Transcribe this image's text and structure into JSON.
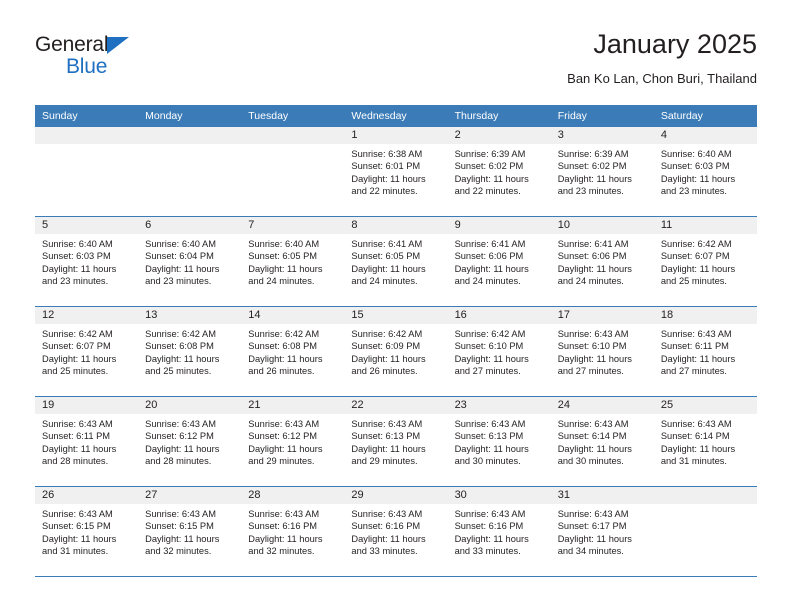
{
  "brand": {
    "line1": "General",
    "line2": "Blue",
    "accent_color": "#1f70c1"
  },
  "header": {
    "title": "January 2025",
    "subtitle": "Ban Ko Lan, Chon Buri, Thailand"
  },
  "theme": {
    "header_blue": "#3b7cb8",
    "daynum_band": "#f0f0f0",
    "text": "#231f20"
  },
  "weekdays": [
    "Sunday",
    "Monday",
    "Tuesday",
    "Wednesday",
    "Thursday",
    "Friday",
    "Saturday"
  ],
  "weeks": [
    [
      {
        "day": "",
        "sunrise": "",
        "sunset": "",
        "daylight1": "",
        "daylight2": ""
      },
      {
        "day": "",
        "sunrise": "",
        "sunset": "",
        "daylight1": "",
        "daylight2": ""
      },
      {
        "day": "",
        "sunrise": "",
        "sunset": "",
        "daylight1": "",
        "daylight2": ""
      },
      {
        "day": "1",
        "sunrise": "Sunrise: 6:38 AM",
        "sunset": "Sunset: 6:01 PM",
        "daylight1": "Daylight: 11 hours",
        "daylight2": "and 22 minutes."
      },
      {
        "day": "2",
        "sunrise": "Sunrise: 6:39 AM",
        "sunset": "Sunset: 6:02 PM",
        "daylight1": "Daylight: 11 hours",
        "daylight2": "and 22 minutes."
      },
      {
        "day": "3",
        "sunrise": "Sunrise: 6:39 AM",
        "sunset": "Sunset: 6:02 PM",
        "daylight1": "Daylight: 11 hours",
        "daylight2": "and 23 minutes."
      },
      {
        "day": "4",
        "sunrise": "Sunrise: 6:40 AM",
        "sunset": "Sunset: 6:03 PM",
        "daylight1": "Daylight: 11 hours",
        "daylight2": "and 23 minutes."
      }
    ],
    [
      {
        "day": "5",
        "sunrise": "Sunrise: 6:40 AM",
        "sunset": "Sunset: 6:03 PM",
        "daylight1": "Daylight: 11 hours",
        "daylight2": "and 23 minutes."
      },
      {
        "day": "6",
        "sunrise": "Sunrise: 6:40 AM",
        "sunset": "Sunset: 6:04 PM",
        "daylight1": "Daylight: 11 hours",
        "daylight2": "and 23 minutes."
      },
      {
        "day": "7",
        "sunrise": "Sunrise: 6:40 AM",
        "sunset": "Sunset: 6:05 PM",
        "daylight1": "Daylight: 11 hours",
        "daylight2": "and 24 minutes."
      },
      {
        "day": "8",
        "sunrise": "Sunrise: 6:41 AM",
        "sunset": "Sunset: 6:05 PM",
        "daylight1": "Daylight: 11 hours",
        "daylight2": "and 24 minutes."
      },
      {
        "day": "9",
        "sunrise": "Sunrise: 6:41 AM",
        "sunset": "Sunset: 6:06 PM",
        "daylight1": "Daylight: 11 hours",
        "daylight2": "and 24 minutes."
      },
      {
        "day": "10",
        "sunrise": "Sunrise: 6:41 AM",
        "sunset": "Sunset: 6:06 PM",
        "daylight1": "Daylight: 11 hours",
        "daylight2": "and 24 minutes."
      },
      {
        "day": "11",
        "sunrise": "Sunrise: 6:42 AM",
        "sunset": "Sunset: 6:07 PM",
        "daylight1": "Daylight: 11 hours",
        "daylight2": "and 25 minutes."
      }
    ],
    [
      {
        "day": "12",
        "sunrise": "Sunrise: 6:42 AM",
        "sunset": "Sunset: 6:07 PM",
        "daylight1": "Daylight: 11 hours",
        "daylight2": "and 25 minutes."
      },
      {
        "day": "13",
        "sunrise": "Sunrise: 6:42 AM",
        "sunset": "Sunset: 6:08 PM",
        "daylight1": "Daylight: 11 hours",
        "daylight2": "and 25 minutes."
      },
      {
        "day": "14",
        "sunrise": "Sunrise: 6:42 AM",
        "sunset": "Sunset: 6:08 PM",
        "daylight1": "Daylight: 11 hours",
        "daylight2": "and 26 minutes."
      },
      {
        "day": "15",
        "sunrise": "Sunrise: 6:42 AM",
        "sunset": "Sunset: 6:09 PM",
        "daylight1": "Daylight: 11 hours",
        "daylight2": "and 26 minutes."
      },
      {
        "day": "16",
        "sunrise": "Sunrise: 6:42 AM",
        "sunset": "Sunset: 6:10 PM",
        "daylight1": "Daylight: 11 hours",
        "daylight2": "and 27 minutes."
      },
      {
        "day": "17",
        "sunrise": "Sunrise: 6:43 AM",
        "sunset": "Sunset: 6:10 PM",
        "daylight1": "Daylight: 11 hours",
        "daylight2": "and 27 minutes."
      },
      {
        "day": "18",
        "sunrise": "Sunrise: 6:43 AM",
        "sunset": "Sunset: 6:11 PM",
        "daylight1": "Daylight: 11 hours",
        "daylight2": "and 27 minutes."
      }
    ],
    [
      {
        "day": "19",
        "sunrise": "Sunrise: 6:43 AM",
        "sunset": "Sunset: 6:11 PM",
        "daylight1": "Daylight: 11 hours",
        "daylight2": "and 28 minutes."
      },
      {
        "day": "20",
        "sunrise": "Sunrise: 6:43 AM",
        "sunset": "Sunset: 6:12 PM",
        "daylight1": "Daylight: 11 hours",
        "daylight2": "and 28 minutes."
      },
      {
        "day": "21",
        "sunrise": "Sunrise: 6:43 AM",
        "sunset": "Sunset: 6:12 PM",
        "daylight1": "Daylight: 11 hours",
        "daylight2": "and 29 minutes."
      },
      {
        "day": "22",
        "sunrise": "Sunrise: 6:43 AM",
        "sunset": "Sunset: 6:13 PM",
        "daylight1": "Daylight: 11 hours",
        "daylight2": "and 29 minutes."
      },
      {
        "day": "23",
        "sunrise": "Sunrise: 6:43 AM",
        "sunset": "Sunset: 6:13 PM",
        "daylight1": "Daylight: 11 hours",
        "daylight2": "and 30 minutes."
      },
      {
        "day": "24",
        "sunrise": "Sunrise: 6:43 AM",
        "sunset": "Sunset: 6:14 PM",
        "daylight1": "Daylight: 11 hours",
        "daylight2": "and 30 minutes."
      },
      {
        "day": "25",
        "sunrise": "Sunrise: 6:43 AM",
        "sunset": "Sunset: 6:14 PM",
        "daylight1": "Daylight: 11 hours",
        "daylight2": "and 31 minutes."
      }
    ],
    [
      {
        "day": "26",
        "sunrise": "Sunrise: 6:43 AM",
        "sunset": "Sunset: 6:15 PM",
        "daylight1": "Daylight: 11 hours",
        "daylight2": "and 31 minutes."
      },
      {
        "day": "27",
        "sunrise": "Sunrise: 6:43 AM",
        "sunset": "Sunset: 6:15 PM",
        "daylight1": "Daylight: 11 hours",
        "daylight2": "and 32 minutes."
      },
      {
        "day": "28",
        "sunrise": "Sunrise: 6:43 AM",
        "sunset": "Sunset: 6:16 PM",
        "daylight1": "Daylight: 11 hours",
        "daylight2": "and 32 minutes."
      },
      {
        "day": "29",
        "sunrise": "Sunrise: 6:43 AM",
        "sunset": "Sunset: 6:16 PM",
        "daylight1": "Daylight: 11 hours",
        "daylight2": "and 33 minutes."
      },
      {
        "day": "30",
        "sunrise": "Sunrise: 6:43 AM",
        "sunset": "Sunset: 6:16 PM",
        "daylight1": "Daylight: 11 hours",
        "daylight2": "and 33 minutes."
      },
      {
        "day": "31",
        "sunrise": "Sunrise: 6:43 AM",
        "sunset": "Sunset: 6:17 PM",
        "daylight1": "Daylight: 11 hours",
        "daylight2": "and 34 minutes."
      },
      {
        "day": "",
        "sunrise": "",
        "sunset": "",
        "daylight1": "",
        "daylight2": ""
      }
    ]
  ]
}
